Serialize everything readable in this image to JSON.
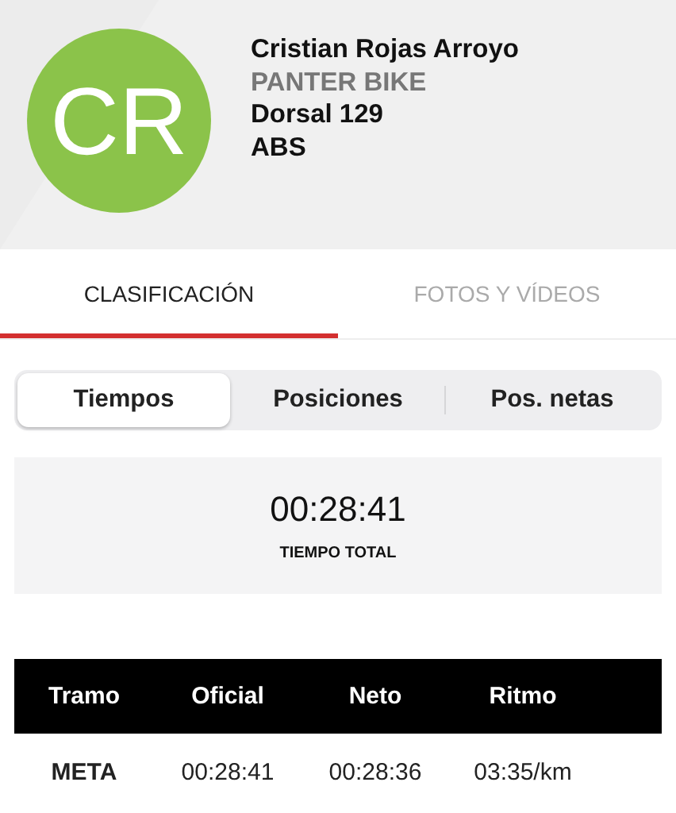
{
  "runner": {
    "initials": "CR",
    "name": "Cristian Rojas Arroyo",
    "team": "PANTER BIKE",
    "bib": "Dorsal 129",
    "category": "ABS"
  },
  "tabs": [
    {
      "label": "CLASIFICACIÓN",
      "selected": true
    },
    {
      "label": "FOTOS Y VÍDEOS",
      "selected": false
    }
  ],
  "segments": [
    {
      "label": "Tiempos",
      "selected": true
    },
    {
      "label": "Posiciones",
      "selected": false
    },
    {
      "label": "Pos. netas",
      "selected": false
    }
  ],
  "total": {
    "time": "00:28:41",
    "label": "TIEMPO TOTAL"
  },
  "table": {
    "columns": [
      "Tramo",
      "Oficial",
      "Neto",
      "Ritmo"
    ],
    "rows": [
      [
        "META",
        "00:28:41",
        "00:28:36",
        "03:35/km"
      ]
    ]
  }
}
